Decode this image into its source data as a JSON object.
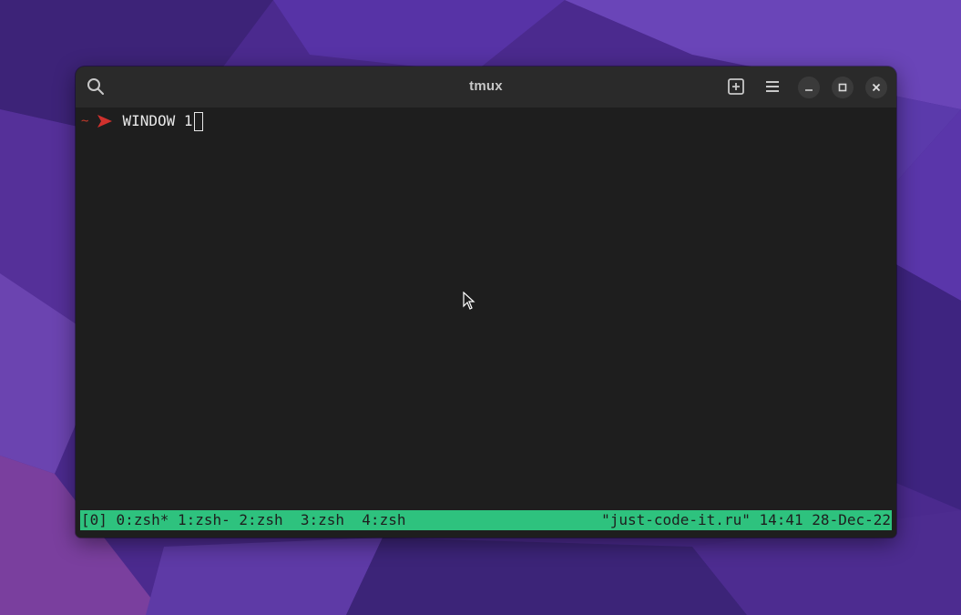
{
  "window": {
    "title": "tmux"
  },
  "titlebar": {
    "icons": [
      "search-icon",
      "new-tab-icon",
      "hamburger-menu-icon",
      "minimize-icon",
      "maximize-icon",
      "close-icon"
    ]
  },
  "terminal": {
    "prompt_dir": "~",
    "prompt_symbol_icon": "arrow-right-icon",
    "command": "WINDOW 1"
  },
  "status_bar": {
    "session": "[0]",
    "windows": [
      {
        "label": "0:zsh*"
      },
      {
        "label": "1:zsh-"
      },
      {
        "label": "2:zsh"
      },
      {
        "label": "3:zsh"
      },
      {
        "label": "4:zsh"
      }
    ],
    "host": "\"just-code-it.ru\"",
    "time": "14:41",
    "date": "28-Dec-22"
  },
  "colors": {
    "status_bar_bg": "#2ec27e",
    "terminal_bg": "#1e1e1e",
    "titlebar_bg": "#2a2a2a",
    "prompt_accent": "#c0392b"
  }
}
